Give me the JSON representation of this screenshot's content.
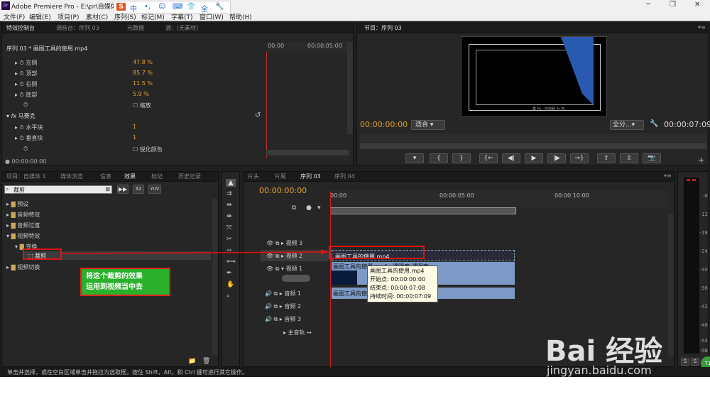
{
  "window": {
    "title": "Adobe Premiere Pro - E:\\pr\\自媒体",
    "logo": "Pr"
  },
  "ime_bar": {
    "items": [
      "S",
      "中",
      "•,",
      "☺",
      "⌨",
      "👕",
      "全",
      "🔧"
    ]
  },
  "menu": [
    "文件(F)",
    "编辑(E)",
    "项目(P)",
    "素材(C)",
    "序列(S)",
    "标记(M)",
    "字幕(T)",
    "窗口(W)",
    "帮助(H)"
  ],
  "effect_controls": {
    "tabs": [
      "特效控制台",
      "调音台：序列 03",
      "元数据",
      "源：(无素材)"
    ],
    "clip_header": "序列 03 * 画图工具的使用.mp4",
    "time_start": "00:00",
    "time_end": "00:00:05:00",
    "props": [
      {
        "label": "左侧",
        "value": "47.8 %"
      },
      {
        "label": "顶部",
        "value": "85.7 %"
      },
      {
        "label": "右侧",
        "value": "11.5 %"
      },
      {
        "label": "底部",
        "value": "5.9 %"
      }
    ],
    "zoom_label": "缩放",
    "mosaic": {
      "name": "马赛克",
      "horizontal_label": "水平块",
      "horizontal_value": "1",
      "vertical_label": "垂直块",
      "vertical_value": "1",
      "sharpen_label": "锐化颜色"
    },
    "footer_time": "00:00:00:00"
  },
  "program_monitor": {
    "tab": "节目：序列 03",
    "timecode": "00:00:00:00",
    "fit": "适合",
    "quality": "全分...",
    "duration": "00:00:07:09",
    "frame_text": "集 Ps · 拍视频 为 你"
  },
  "effects_panel": {
    "tabs": [
      "项目：自媒体 1",
      "媒体浏览",
      "信息",
      "效果",
      "标记",
      "历史记录"
    ],
    "search": "裁剪",
    "buttons": [
      "32",
      "YUV"
    ],
    "tree": [
      {
        "label": "预设",
        "level": 0
      },
      {
        "label": "音频特效",
        "level": 0
      },
      {
        "label": "音频过渡",
        "level": 0
      },
      {
        "label": "视频特效",
        "level": 0
      },
      {
        "label": "变换",
        "level": 1
      },
      {
        "label": "裁剪",
        "level": 2
      },
      {
        "label": "视频切换",
        "level": 0
      }
    ]
  },
  "annotation": {
    "line1": "将这个裁剪的效果",
    "line2": "运用到视频当中去"
  },
  "timeline": {
    "tabs": [
      "片头",
      "片尾",
      "序列 03",
      "序列 04"
    ],
    "timecode": "00:00:00:00",
    "ruler": [
      "00:00",
      "00:00:05:00",
      "00:00:10:00"
    ],
    "tracks": [
      "视频 3",
      "视频 2",
      "视频 1",
      "音频 1",
      "音频 2",
      "音频 3",
      "主音轨"
    ],
    "clip_name": "画图工具的使用.mp4",
    "clip_v1_label": "画图工具的使用.mp4",
    "clip_v1_extra": "透明度:透明度 ▾",
    "clip_a1_label": "画图工具的使"
  },
  "tooltip": {
    "name": "画图工具的使用.mp4",
    "start": "开始点: 00:00:00:00",
    "end": "结束点: 00:00:07:08",
    "duration": "持续时间: 00:00:07:09"
  },
  "meter": {
    "labels": [
      "-6",
      "-12",
      "-18",
      "-24",
      "-30",
      "-36",
      "-42",
      "-48",
      "-54",
      "dB"
    ],
    "buttons": [
      "S",
      "S"
    ],
    "badge": "71"
  },
  "status_text": "单击并选择，或在空白区域单击并拖拉为选取框。按住 Shift，Alt，和 Ctrl 键可进行其它操作。",
  "watermark": {
    "brand": "Bai 经验",
    "url": "jingyan.baidu.com"
  },
  "colors": {
    "accent": "#e6a32a",
    "clip": "#7d9ac7",
    "annotation_bg": "#2ab02a",
    "highlight": "#e01010"
  }
}
